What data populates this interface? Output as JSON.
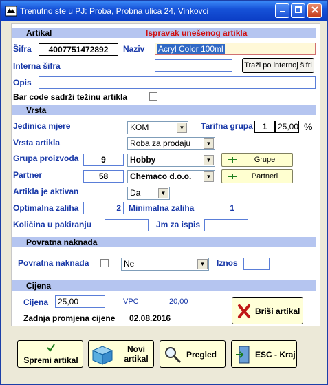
{
  "window": {
    "title": "Trenutno ste u PJ: Proba,  Probna ulica 24, Vinkovci"
  },
  "artikal": {
    "band": "Artikal",
    "mode_notice": "Ispravak unešenog artikla",
    "sifra_label": "Šifra",
    "sifra": "4007751472892",
    "naziv_label": "Naziv",
    "naziv": "Acryl Color 100ml",
    "interna_label": "Interna šifra",
    "interna": "",
    "interna_button": "Traži po internoj šifri",
    "opis_label": "Opis",
    "opis": "",
    "barcode_label": "Bar code sadrži težinu artikla",
    "barcode_checked": false
  },
  "vrsta": {
    "band": "Vrsta",
    "jedinica_label": "Jedinica mjere",
    "jedinica": "KOM",
    "tarifna_label": "Tarifna grupa",
    "tarifna_grupa": "1",
    "tarifna_stopa": "25,00",
    "percent": "%",
    "vrsta_label": "Vrsta artikla",
    "vrsta": "Roba za prodaju",
    "grupa_label": "Grupa proizvoda",
    "grupa_id": "9",
    "grupa": "Hobby",
    "grupe_button": "Grupe",
    "partner_label": "Partner",
    "partner_id": "58",
    "partner": "Chemaco d.o.o.",
    "partneri_button": "Partneri",
    "aktivan_label": "Artikla je aktivan",
    "aktivan": "Da",
    "opt_label": "Optimalna zaliha",
    "opt": "2",
    "min_label": "Minimalna zaliha",
    "min": "1",
    "kol_label": "Količina u pakiranju",
    "kol": "",
    "jm_label": "Jm za ispis",
    "jm": ""
  },
  "povratna": {
    "band": "Povratna naknada",
    "label": "Povratna naknada",
    "checked": false,
    "value": "Ne",
    "iznos_label": "Iznos",
    "iznos": ""
  },
  "cijena": {
    "band": "Cijena",
    "label": "Cijena",
    "value": "25,00",
    "vpc_label": "VPC",
    "vpc": "20,00",
    "promjena_label": "Zadnja promjena cijene",
    "promjena": "02.08.2016",
    "delete_button": "Briši artikal"
  },
  "footer": {
    "save": "Spremi artikal",
    "new_line1": "Novi",
    "new_line2": "artikal",
    "preview": "Pregled",
    "exit": "ESC - Kraj"
  }
}
